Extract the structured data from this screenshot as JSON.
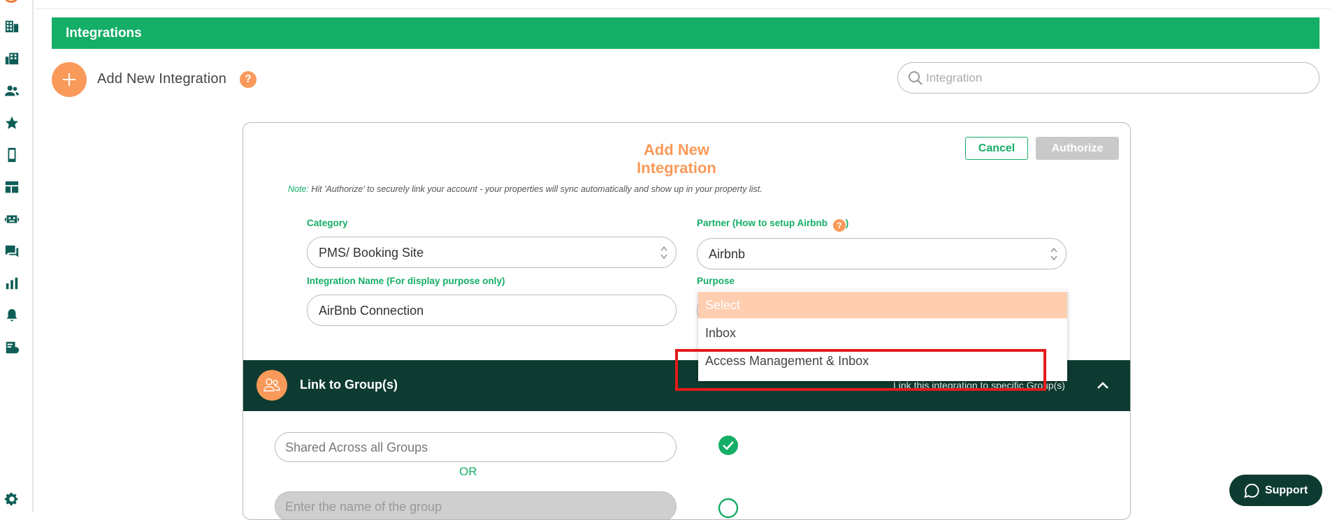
{
  "sidebar": {
    "items": [
      "brand-mark-icon",
      "building-icon",
      "buildings-icon",
      "users-icon",
      "star-icon",
      "mobile-icon",
      "dashboard-icon",
      "robot-icon",
      "chat-icon",
      "bar-chart-icon",
      "bell-icon",
      "billing-icon"
    ],
    "settings_icon": "gear-icon"
  },
  "banner": {
    "title": "Integrations"
  },
  "header": {
    "add_title": "Add New Integration",
    "help_glyph": "?"
  },
  "search": {
    "placeholder": "Integration"
  },
  "modal": {
    "title": "Add New Integration",
    "cancel_label": "Cancel",
    "authorize_label": "Authorize",
    "note_label": "Note:",
    "note_text": "Hit 'Authorize' to securely link your account - your properties will sync automatically and show up in your property list.",
    "category_label": "Category",
    "category_value": "PMS/ Booking Site",
    "partner_label": "Partner (How to setup Airbnb",
    "partner_label_close": ")",
    "partner_value": "Airbnb",
    "integration_name_label": "Integration Name (For display purpose only)",
    "integration_name_value": "AirBnb Connection",
    "purpose_label": "Purpose",
    "purpose_dropdown": {
      "options": [
        "Select",
        "Inbox",
        "Access Management & Inbox"
      ],
      "selected": "Select"
    }
  },
  "groups": {
    "title": "Link to Group(s)",
    "hint": "Link this integration to specific Group(s)",
    "shared_placeholder": "Shared Across all Groups",
    "or_text": "OR",
    "group_name_placeholder": "Enter the name of the group"
  },
  "support": {
    "label": "Support"
  },
  "colors": {
    "brand_green": "#14ae66",
    "dark_green": "#0d3b31",
    "accent_orange": "#f99a5a",
    "highlight_red": "#e31b1b"
  }
}
